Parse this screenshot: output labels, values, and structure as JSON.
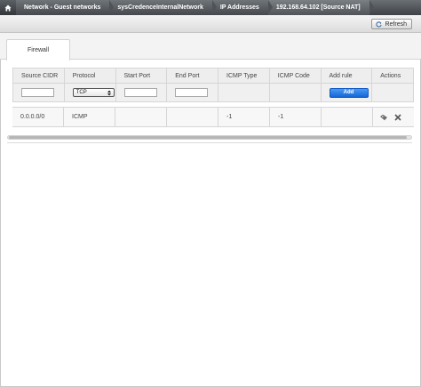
{
  "breadcrumb": {
    "items": [
      "Network - Guest networks",
      "sysCredenceInternalNetwork",
      "IP Addresses",
      "192.168.64.102 [Source NAT]"
    ]
  },
  "toolbar": {
    "refresh_label": "Refresh"
  },
  "tabs": [
    {
      "label": "Firewall"
    }
  ],
  "table": {
    "headers": [
      "Source CIDR",
      "Protocol",
      "Start Port",
      "End Port",
      "ICMP Type",
      "ICMP Code",
      "Add rule",
      "Actions"
    ],
    "new_rule": {
      "source_cidr": "",
      "protocol": "TCP",
      "start_port": "",
      "end_port": "",
      "add_label": "Add"
    },
    "rows": [
      {
        "source_cidr": "0.0.0.0/0",
        "protocol": "ICMP",
        "start_port": "",
        "end_port": "",
        "icmp_type": "-1",
        "icmp_code": "-1",
        "add_rule": ""
      }
    ]
  }
}
